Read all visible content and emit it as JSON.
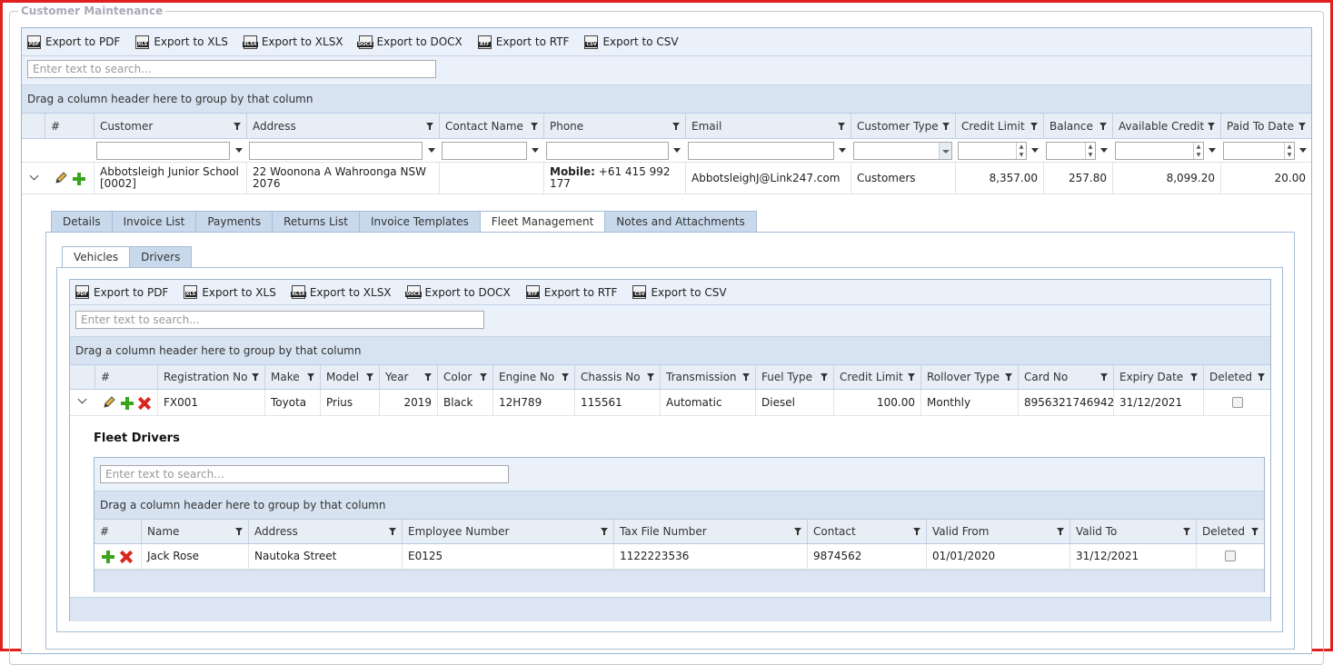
{
  "title": "Customer Maintenance",
  "export_buttons": [
    "Export to PDF",
    "Export to XLS",
    "Export to XLSX",
    "Export to DOCX",
    "Export to RTF",
    "Export to CSV"
  ],
  "export_icons": [
    "PDF",
    "XLS",
    "XLSX",
    "DOCX",
    "RTF",
    "CSV"
  ],
  "search_placeholder": "Enter text to search...",
  "group_hint": "Drag a column header here to group by that column",
  "customers": {
    "columns": [
      "#",
      "Customer",
      "Address",
      "Contact Name",
      "Phone",
      "Email",
      "Customer Type",
      "Credit Limit",
      "Balance",
      "Available Credit",
      "Paid To Date"
    ],
    "row": {
      "customer": "Abbotsleigh Junior School [0002]",
      "address": "22 Woonona A Wahroonga NSW 2076",
      "contact": "",
      "phone_label": "Mobile:",
      "phone_value": "+61 415 992 177",
      "email": "AbbotsleighJ@Link247.com",
      "type": "Customers",
      "credit_limit": "8,357.00",
      "balance": "257.80",
      "available_credit": "8,099.20",
      "paid_to_date": "20.00"
    }
  },
  "detail_tabs": [
    "Details",
    "Invoice List",
    "Payments",
    "Returns List",
    "Invoice Templates",
    "Fleet Management",
    "Notes and Attachments"
  ],
  "fleet_tabs": [
    "Vehicles",
    "Drivers"
  ],
  "vehicles": {
    "columns": [
      "#",
      "Registration No",
      "Make",
      "Model",
      "Year",
      "Color",
      "Engine No",
      "Chassis No",
      "Transmission",
      "Fuel Type",
      "Credit Limit",
      "Rollover Type",
      "Card No",
      "Expiry Date",
      "Deleted"
    ],
    "row": {
      "registration": "FX001",
      "make": "Toyota",
      "model": "Prius",
      "year": "2019",
      "color": "Black",
      "engine": "12H789",
      "chassis": "115561",
      "transmission": "Automatic",
      "fuel": "Diesel",
      "credit_limit": "100.00",
      "rollover": "Monthly",
      "card": "8956321746942",
      "expiry": "31/12/2021"
    }
  },
  "fleet_drivers": {
    "heading": "Fleet Drivers",
    "columns": [
      "#",
      "Name",
      "Address",
      "Employee Number",
      "Tax File Number",
      "Contact",
      "Valid From",
      "Valid To",
      "Deleted"
    ],
    "row": {
      "name": "Jack Rose",
      "address": "Nautoka Street",
      "employee": "E0125",
      "tfn": "1122223536",
      "contact": "9874562",
      "valid_from": "01/01/2020",
      "valid_to": "31/12/2021"
    }
  },
  "colors": {
    "frame": "#e01f1f",
    "accent": "#c9d9ec",
    "add": "#3aa51a",
    "delete": "#d9261c"
  }
}
